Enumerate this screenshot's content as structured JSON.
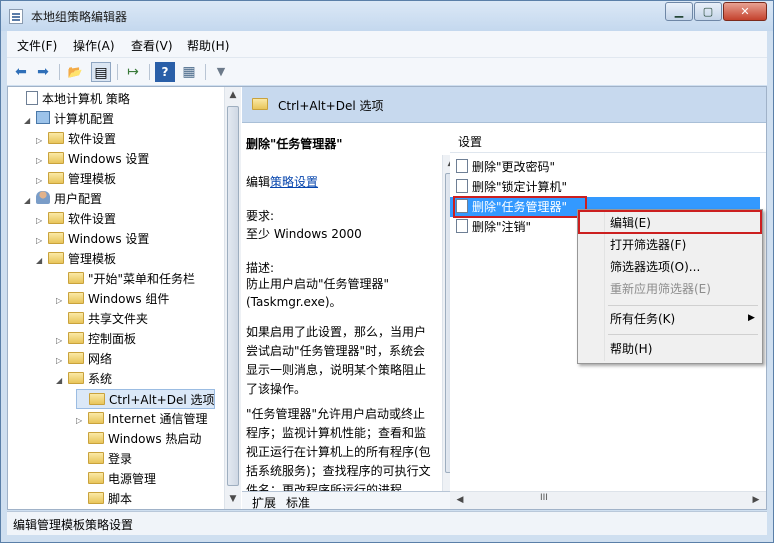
{
  "window": {
    "title": "本地组策略编辑器",
    "buttons": [
      "▁",
      "▢",
      "✕"
    ]
  },
  "menu": [
    "文件(F)",
    "操作(A)",
    "查看(V)",
    "帮助(H)"
  ],
  "toolbar": {
    "icons": [
      "back-arrow-icon",
      "forward-arrow-icon",
      "up-folder-icon",
      "show-hide-tree-icon",
      "export-list-icon",
      "help-icon",
      "properties-icon",
      "filter-icon"
    ],
    "glyphs": [
      "⬅",
      "➡",
      "📂",
      "▤",
      "↦",
      "?",
      "▦",
      "▼"
    ]
  },
  "tree": {
    "items": [
      {
        "label": "本地计算机 策略",
        "level": 0,
        "expand": "",
        "icon": "doc"
      },
      {
        "label": "计算机配置",
        "level": 1,
        "expand": "◢",
        "icon": "pc"
      },
      {
        "label": "软件设置",
        "level": 2,
        "expand": "▷",
        "icon": "folder"
      },
      {
        "label": "Windows 设置",
        "level": 2,
        "expand": "▷",
        "icon": "folder"
      },
      {
        "label": "管理模板",
        "level": 2,
        "expand": "▷",
        "icon": "folder"
      },
      {
        "label": "用户配置",
        "level": 1,
        "expand": "◢",
        "icon": "user"
      },
      {
        "label": "软件设置",
        "level": 2,
        "expand": "▷",
        "icon": "folder"
      },
      {
        "label": "Windows 设置",
        "level": 2,
        "expand": "▷",
        "icon": "folder"
      },
      {
        "label": "管理模板",
        "level": 2,
        "expand": "◢",
        "icon": "folder"
      },
      {
        "label": "\"开始\"菜单和任务栏",
        "level": 3,
        "expand": "",
        "icon": "folder"
      },
      {
        "label": "Windows 组件",
        "level": 3,
        "expand": "▷",
        "icon": "folder"
      },
      {
        "label": "共享文件夹",
        "level": 3,
        "expand": "",
        "icon": "folder"
      },
      {
        "label": "控制面板",
        "level": 3,
        "expand": "▷",
        "icon": "folder"
      },
      {
        "label": "网络",
        "level": 3,
        "expand": "▷",
        "icon": "folder"
      },
      {
        "label": "系统",
        "level": 3,
        "expand": "◢",
        "icon": "folder"
      },
      {
        "label": "Ctrl+Alt+Del 选项",
        "level": 4,
        "expand": "",
        "icon": "folder",
        "selected": true
      },
      {
        "label": "Internet 通信管理",
        "level": 4,
        "expand": "▷",
        "icon": "folder"
      },
      {
        "label": "Windows 热启动",
        "level": 4,
        "expand": "",
        "icon": "folder"
      },
      {
        "label": "登录",
        "level": 4,
        "expand": "",
        "icon": "folder"
      },
      {
        "label": "电源管理",
        "level": 4,
        "expand": "",
        "icon": "folder"
      },
      {
        "label": "脚本",
        "level": 4,
        "expand": "",
        "icon": "folder"
      }
    ]
  },
  "pane": {
    "header": "Ctrl+Alt+Del 选项",
    "desc": {
      "title": "删除\"任务管理器\"",
      "edit_prefix": "编辑",
      "edit_link": "策略设置",
      "req_label": "要求:",
      "req_value": "至少 Windows 2000",
      "desc_label": "描述:",
      "desc_line1": "防止用户启动\"任务管理器\"",
      "desc_line2": "(Taskmgr.exe)。",
      "para1": "如果启用了此设置，那么，当用户尝试启动\"任务管理器\"时，系统会显示一则消息，说明某个策略阻止了该操作。",
      "para2": "\"任务管理器\"允许用户启动或终止程序；监视计算机性能；查看和监视正运行在计算机上的所有程序(包括系统服务)；查找程序的可执行文件名；更改程序所运行的进程"
    },
    "settings_header": "设置",
    "settings": [
      "删除\"更改密码\"",
      "删除\"锁定计算机\"",
      "删除\"任务管理器\"",
      "删除\"注销\""
    ],
    "tabs": [
      "扩展",
      "标准"
    ],
    "hscroll_label": "III"
  },
  "context_menu": {
    "items": [
      {
        "label": "编辑(E)",
        "disabled": false
      },
      {
        "label": "打开筛选器(F)",
        "disabled": false
      },
      {
        "label": "筛选器选项(O)...",
        "disabled": false
      },
      {
        "label": "重新应用筛选器(E)",
        "disabled": true
      },
      {
        "label": "所有任务(K)",
        "disabled": false,
        "submenu": true
      },
      {
        "label": "帮助(H)",
        "disabled": false
      }
    ]
  },
  "status": "编辑管理模板策略设置"
}
